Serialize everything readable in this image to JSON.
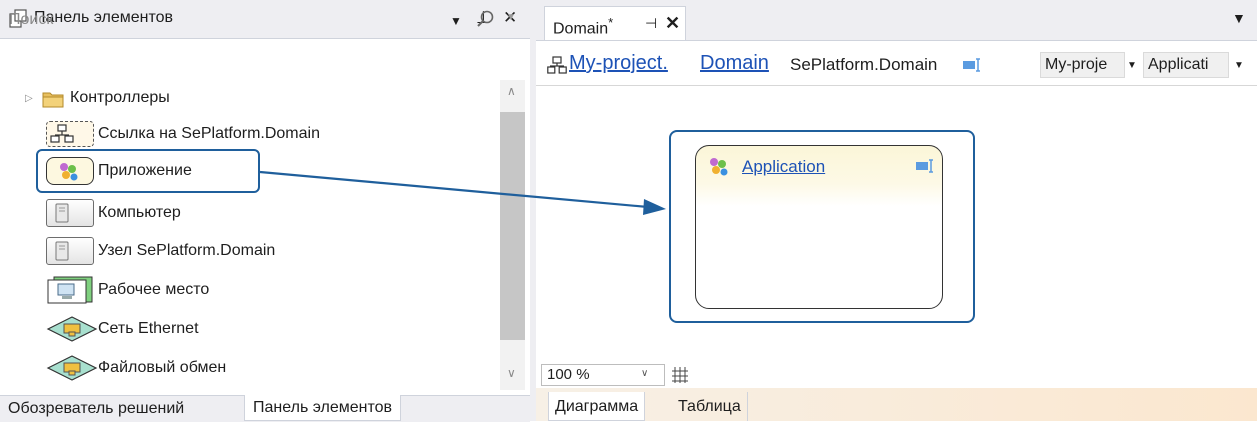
{
  "toolbox": {
    "title": "Панель элементов",
    "header_buttons": {
      "dropdown": "▼",
      "pin": "⊥",
      "close": "✕"
    },
    "search_placeholder": "Поиск",
    "items": [
      {
        "label": "Контроллеры",
        "icon": "folder-icon"
      },
      {
        "label": "Ссылка на SePlatform.Domain",
        "icon": "domain-link-icon"
      },
      {
        "label": "Приложение",
        "icon": "application-icon"
      },
      {
        "label": "Компьютер",
        "icon": "computer-icon"
      },
      {
        "label": "Узел SePlatform.Domain",
        "icon": "node-icon"
      },
      {
        "label": "Рабочее место",
        "icon": "workstation-icon"
      },
      {
        "label": "Сеть Ethernet",
        "icon": "network-icon"
      },
      {
        "label": "Файловый обмен",
        "icon": "file-exchange-icon"
      }
    ],
    "bottom_tabs": [
      "Обозреватель решений",
      "Панель элементов"
    ],
    "active_bottom_tab": "Панель элементов"
  },
  "document": {
    "tab_title": "Domain",
    "tab_modified": "*",
    "tab_pin": "⊣",
    "tab_close": "✕",
    "menu_glyph": "▼"
  },
  "navbar": {
    "link1": "My-project.",
    "link2": "Domain",
    "plain": "SePlatform.Domain",
    "combo1": "My-proje",
    "combo2": "Applicati",
    "arrow": "▼"
  },
  "canvas": {
    "shape_title": "Application"
  },
  "zoom": {
    "value": "100 %",
    "arrow": "∨"
  },
  "designer_tabs": [
    "Диаграмма",
    "Таблица"
  ],
  "colors": {
    "accent": "#1f5f9c",
    "link": "#1d52b6",
    "panel_bg": "#eeeef2"
  }
}
